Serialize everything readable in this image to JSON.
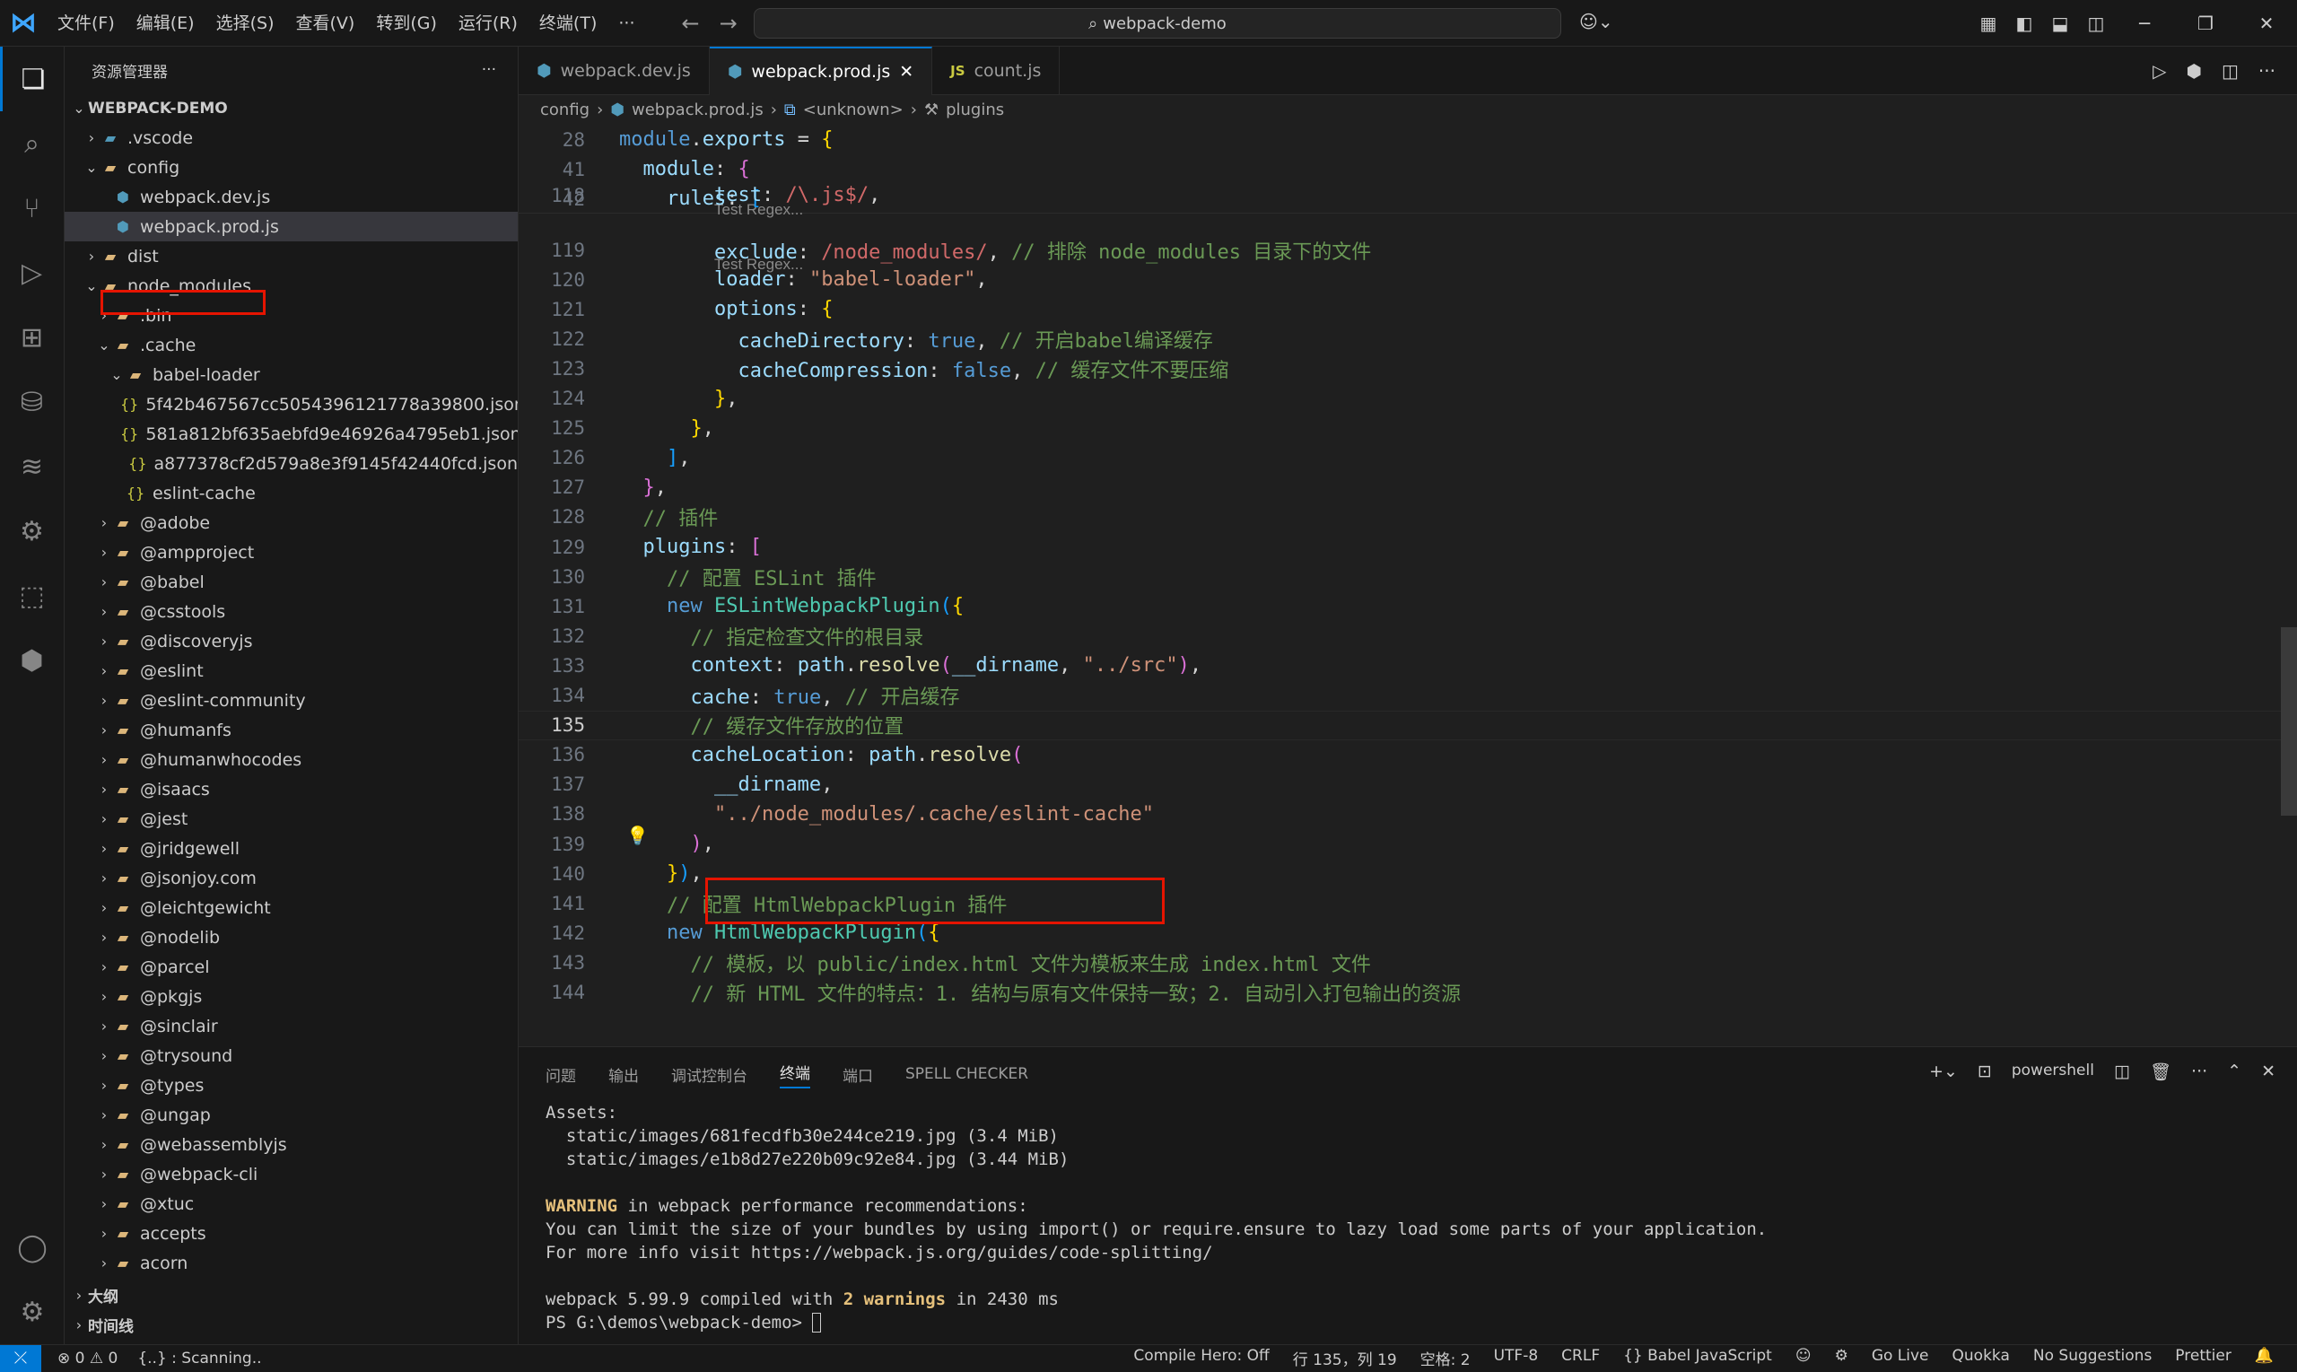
{
  "title_bar": {
    "menus": [
      "文件(F)",
      "编辑(E)",
      "选择(S)",
      "查看(V)",
      "转到(G)",
      "运行(R)",
      "终端(T)",
      "···"
    ],
    "search_text": "webpack-demo"
  },
  "sidebar": {
    "title": "资源管理器",
    "more": "···",
    "root": "WEBPACK-DEMO",
    "items": [
      {
        "label": ".vscode",
        "depth": 1,
        "open": false,
        "kind": "folder-vscode"
      },
      {
        "label": "config",
        "depth": 1,
        "open": true,
        "kind": "folder-config"
      },
      {
        "label": "webpack.dev.js",
        "depth": 2,
        "kind": "webpack"
      },
      {
        "label": "webpack.prod.js",
        "depth": 2,
        "kind": "webpack",
        "selected": true
      },
      {
        "label": "dist",
        "depth": 1,
        "open": false,
        "kind": "folder"
      },
      {
        "label": "node_modules",
        "depth": 1,
        "open": true,
        "kind": "folder-node"
      },
      {
        "label": ".bin",
        "depth": 2,
        "open": false,
        "kind": "folder-bin"
      },
      {
        "label": ".cache",
        "depth": 2,
        "open": true,
        "kind": "folder"
      },
      {
        "label": "babel-loader",
        "depth": 3,
        "open": true,
        "kind": "folder"
      },
      {
        "label": "5f42b467567cc5054396121778a39800.json",
        "depth": 4,
        "kind": "json"
      },
      {
        "label": "581a812bf635aebfd9e46926a4795eb1.json",
        "depth": 4,
        "kind": "json"
      },
      {
        "label": "a877378cf2d579a8e3f9145f42440fcd.json",
        "depth": 4,
        "kind": "json"
      },
      {
        "label": "eslint-cache",
        "depth": 3,
        "kind": "json"
      },
      {
        "label": "@adobe",
        "depth": 2,
        "open": false,
        "kind": "folder"
      },
      {
        "label": "@ampproject",
        "depth": 2,
        "open": false,
        "kind": "folder"
      },
      {
        "label": "@babel",
        "depth": 2,
        "open": false,
        "kind": "folder"
      },
      {
        "label": "@csstools",
        "depth": 2,
        "open": false,
        "kind": "folder"
      },
      {
        "label": "@discoveryjs",
        "depth": 2,
        "open": false,
        "kind": "folder"
      },
      {
        "label": "@eslint",
        "depth": 2,
        "open": false,
        "kind": "folder"
      },
      {
        "label": "@eslint-community",
        "depth": 2,
        "open": false,
        "kind": "folder"
      },
      {
        "label": "@humanfs",
        "depth": 2,
        "open": false,
        "kind": "folder"
      },
      {
        "label": "@humanwhocodes",
        "depth": 2,
        "open": false,
        "kind": "folder"
      },
      {
        "label": "@isaacs",
        "depth": 2,
        "open": false,
        "kind": "folder"
      },
      {
        "label": "@jest",
        "depth": 2,
        "open": false,
        "kind": "folder"
      },
      {
        "label": "@jridgewell",
        "depth": 2,
        "open": false,
        "kind": "folder"
      },
      {
        "label": "@jsonjoy.com",
        "depth": 2,
        "open": false,
        "kind": "folder"
      },
      {
        "label": "@leichtgewicht",
        "depth": 2,
        "open": false,
        "kind": "folder"
      },
      {
        "label": "@nodelib",
        "depth": 2,
        "open": false,
        "kind": "folder"
      },
      {
        "label": "@parcel",
        "depth": 2,
        "open": false,
        "kind": "folder"
      },
      {
        "label": "@pkgjs",
        "depth": 2,
        "open": false,
        "kind": "folder"
      },
      {
        "label": "@sinclair",
        "depth": 2,
        "open": false,
        "kind": "folder"
      },
      {
        "label": "@trysound",
        "depth": 2,
        "open": false,
        "kind": "folder"
      },
      {
        "label": "@types",
        "depth": 2,
        "open": false,
        "kind": "folder-ts"
      },
      {
        "label": "@ungap",
        "depth": 2,
        "open": false,
        "kind": "folder"
      },
      {
        "label": "@webassemblyjs",
        "depth": 2,
        "open": false,
        "kind": "folder"
      },
      {
        "label": "@webpack-cli",
        "depth": 2,
        "open": false,
        "kind": "folder"
      },
      {
        "label": "@xtuc",
        "depth": 2,
        "open": false,
        "kind": "folder"
      },
      {
        "label": "accepts",
        "depth": 2,
        "open": false,
        "kind": "folder"
      },
      {
        "label": "acorn",
        "depth": 2,
        "open": false,
        "kind": "folder"
      }
    ],
    "outline": "大纲",
    "timeline": "时间线"
  },
  "tabs": [
    {
      "label": "webpack.dev.js",
      "icon": "webpack"
    },
    {
      "label": "webpack.prod.js",
      "icon": "webpack",
      "active": true,
      "close": "✕"
    },
    {
      "label": "count.js",
      "icon": "JS"
    }
  ],
  "breadcrumb": {
    "seg1": "config",
    "seg2": "webpack.prod.js",
    "seg3": "<unknown>",
    "seg4": "plugins"
  },
  "code_hints": {
    "h1": "Test Regex...",
    "h2": "Test Regex..."
  },
  "code_lines": [
    {
      "n": "28",
      "tokens": [
        [
          "k",
          "module"
        ],
        [
          "d",
          "."
        ],
        [
          "p",
          "exports"
        ],
        [
          "d",
          " = "
        ],
        [
          "b1",
          "{"
        ]
      ]
    },
    {
      "n": "41",
      "tokens": [
        [
          "d",
          "  "
        ],
        [
          "p",
          "module"
        ],
        [
          "d",
          ": "
        ],
        [
          "b2",
          "{"
        ]
      ]
    },
    {
      "n": "42",
      "tokens": [
        [
          "d",
          "    "
        ],
        [
          "p",
          "rules"
        ],
        [
          "d",
          ": "
        ],
        [
          "b3",
          "["
        ]
      ]
    },
    {
      "n": "118",
      "tokens": [
        [
          "d",
          "        "
        ],
        [
          "p",
          "test"
        ],
        [
          "d",
          ": "
        ],
        [
          "r",
          "/\\.js$/"
        ],
        [
          "d",
          ","
        ]
      ]
    },
    {
      "n": "119",
      "tokens": [
        [
          "d",
          "        "
        ],
        [
          "p",
          "exclude"
        ],
        [
          "d",
          ": "
        ],
        [
          "r",
          "/node_modules/"
        ],
        [
          "d",
          ", "
        ],
        [
          "c",
          "// 排除 node_modules 目录下的文件"
        ]
      ]
    },
    {
      "n": "120",
      "tokens": [
        [
          "d",
          "        "
        ],
        [
          "p",
          "loader"
        ],
        [
          "d",
          ": "
        ],
        [
          "s",
          "\"babel-loader\""
        ],
        [
          "d",
          ","
        ]
      ]
    },
    {
      "n": "121",
      "tokens": [
        [
          "d",
          "        "
        ],
        [
          "p",
          "options"
        ],
        [
          "d",
          ": "
        ],
        [
          "b1",
          "{"
        ]
      ]
    },
    {
      "n": "122",
      "tokens": [
        [
          "d",
          "          "
        ],
        [
          "p",
          "cacheDirectory"
        ],
        [
          "d",
          ": "
        ],
        [
          "k",
          "true"
        ],
        [
          "d",
          ", "
        ],
        [
          "c",
          "// 开启babel编译缓存"
        ]
      ]
    },
    {
      "n": "123",
      "tokens": [
        [
          "d",
          "          "
        ],
        [
          "p",
          "cacheCompression"
        ],
        [
          "d",
          ": "
        ],
        [
          "k",
          "false"
        ],
        [
          "d",
          ", "
        ],
        [
          "c",
          "// 缓存文件不要压缩"
        ]
      ]
    },
    {
      "n": "124",
      "tokens": [
        [
          "d",
          "        "
        ],
        [
          "b1",
          "}"
        ],
        [
          "d",
          ","
        ]
      ]
    },
    {
      "n": "125",
      "tokens": [
        [
          "d",
          "      "
        ],
        [
          "b1",
          "}"
        ],
        [
          "d",
          ","
        ]
      ]
    },
    {
      "n": "126",
      "tokens": [
        [
          "d",
          "    "
        ],
        [
          "b3",
          "]"
        ],
        [
          "d",
          ","
        ]
      ]
    },
    {
      "n": "127",
      "tokens": [
        [
          "d",
          "  "
        ],
        [
          "b2",
          "}"
        ],
        [
          "d",
          ","
        ]
      ]
    },
    {
      "n": "128",
      "tokens": [
        [
          "d",
          "  "
        ],
        [
          "c",
          "// 插件"
        ]
      ]
    },
    {
      "n": "129",
      "tokens": [
        [
          "d",
          "  "
        ],
        [
          "p",
          "plugins"
        ],
        [
          "d",
          ": "
        ],
        [
          "b2",
          "["
        ]
      ]
    },
    {
      "n": "130",
      "tokens": [
        [
          "d",
          "    "
        ],
        [
          "c",
          "// 配置 ESLint 插件"
        ]
      ]
    },
    {
      "n": "131",
      "tokens": [
        [
          "d",
          "    "
        ],
        [
          "k",
          "new "
        ],
        [
          "t",
          "ESLintWebpackPlugin"
        ],
        [
          "b3",
          "("
        ],
        [
          "b1",
          "{"
        ]
      ]
    },
    {
      "n": "132",
      "tokens": [
        [
          "d",
          "      "
        ],
        [
          "c",
          "// 指定检查文件的根目录"
        ]
      ]
    },
    {
      "n": "133",
      "tokens": [
        [
          "d",
          "      "
        ],
        [
          "p",
          "context"
        ],
        [
          "d",
          ": "
        ],
        [
          "p",
          "path"
        ],
        [
          "d",
          "."
        ],
        [
          "f",
          "resolve"
        ],
        [
          "b2",
          "("
        ],
        [
          "p",
          "__dirname"
        ],
        [
          "d",
          ", "
        ],
        [
          "s",
          "\"../src\""
        ],
        [
          "b2",
          ")"
        ],
        [
          "d",
          ","
        ]
      ]
    },
    {
      "n": "134",
      "tokens": [
        [
          "d",
          "      "
        ],
        [
          "p",
          "cache"
        ],
        [
          "d",
          ": "
        ],
        [
          "k",
          "true"
        ],
        [
          "d",
          ", "
        ],
        [
          "c",
          "// 开启缓存"
        ]
      ]
    },
    {
      "n": "135",
      "cur": true,
      "tokens": [
        [
          "d",
          "      "
        ],
        [
          "c",
          "// 缓存文件存放的位置"
        ]
      ]
    },
    {
      "n": "136",
      "tokens": [
        [
          "d",
          "      "
        ],
        [
          "p",
          "cacheLocation"
        ],
        [
          "d",
          ": "
        ],
        [
          "p",
          "path"
        ],
        [
          "d",
          "."
        ],
        [
          "f",
          "resolve"
        ],
        [
          "b2",
          "("
        ]
      ]
    },
    {
      "n": "137",
      "tokens": [
        [
          "d",
          "        "
        ],
        [
          "p",
          "__dirname"
        ],
        [
          "d",
          ","
        ]
      ]
    },
    {
      "n": "138",
      "tokens": [
        [
          "d",
          "        "
        ],
        [
          "s",
          "\"../node_modules/.cache/eslint-cache\""
        ]
      ]
    },
    {
      "n": "139",
      "tokens": [
        [
          "d",
          "      "
        ],
        [
          "b2",
          ")"
        ],
        [
          "d",
          ","
        ]
      ]
    },
    {
      "n": "140",
      "tokens": [
        [
          "d",
          "    "
        ],
        [
          "b1",
          "}"
        ],
        [
          "b3",
          ")"
        ],
        [
          "d",
          ","
        ]
      ]
    },
    {
      "n": "141",
      "tokens": [
        [
          "d",
          "    "
        ],
        [
          "c",
          "// 配置 HtmlWebpackPlugin 插件"
        ]
      ]
    },
    {
      "n": "142",
      "tokens": [
        [
          "d",
          "    "
        ],
        [
          "k",
          "new "
        ],
        [
          "t",
          "HtmlWebpackPlugin"
        ],
        [
          "b3",
          "("
        ],
        [
          "b1",
          "{"
        ]
      ]
    },
    {
      "n": "143",
      "tokens": [
        [
          "d",
          "      "
        ],
        [
          "c",
          "// 模板，以 public/index.html 文件为模板来生成 index.html 文件"
        ]
      ]
    },
    {
      "n": "144",
      "tokens": [
        [
          "d",
          "      "
        ],
        [
          "c",
          "// 新 HTML 文件的特点：1. 结构与原有文件保持一致；2. 自动引入打包输出的资源"
        ]
      ]
    }
  ],
  "panel": {
    "tabs": [
      "问题",
      "输出",
      "调试控制台",
      "终端",
      "端口",
      "SPELL CHECKER"
    ],
    "active_tab": "终端",
    "shell": "powershell"
  },
  "terminal": {
    "assets": "Assets:",
    "img1": "  static/images/681fecdfb30e244ce219.jpg (3.4 MiB)",
    "img2": "  static/images/e1b8d27e220b09c92e84.jpg (3.44 MiB)",
    "warn_word": "WARNING",
    "warn_rest": " in webpack performance recommendations:",
    "limit": "You can limit the size of your bundles by using import() or require.ensure to lazy load some parts of your application.",
    "info": "For more info visit https://webpack.js.org/guides/code-splitting/",
    "compiled_a": "webpack 5.99.9 compiled with ",
    "compiled_b": "2 warnings",
    "compiled_c": " in 2430 ms",
    "prompt": "PS G:\\demos\\webpack-demo> "
  },
  "statusbar": {
    "problems": "⊗ 0 ⚠ 0",
    "scanning": "{..} : Scanning..",
    "compile_hero": "Compile Hero: Off",
    "position": "行 135，列 19",
    "spaces": "空格: 2",
    "encoding": "UTF-8",
    "eol": "CRLF",
    "language": "{} Babel JavaScript",
    "golive": "Go Live",
    "quokka": "Quokka",
    "suggestions": "No Suggestions",
    "prettier": "Prettier"
  }
}
